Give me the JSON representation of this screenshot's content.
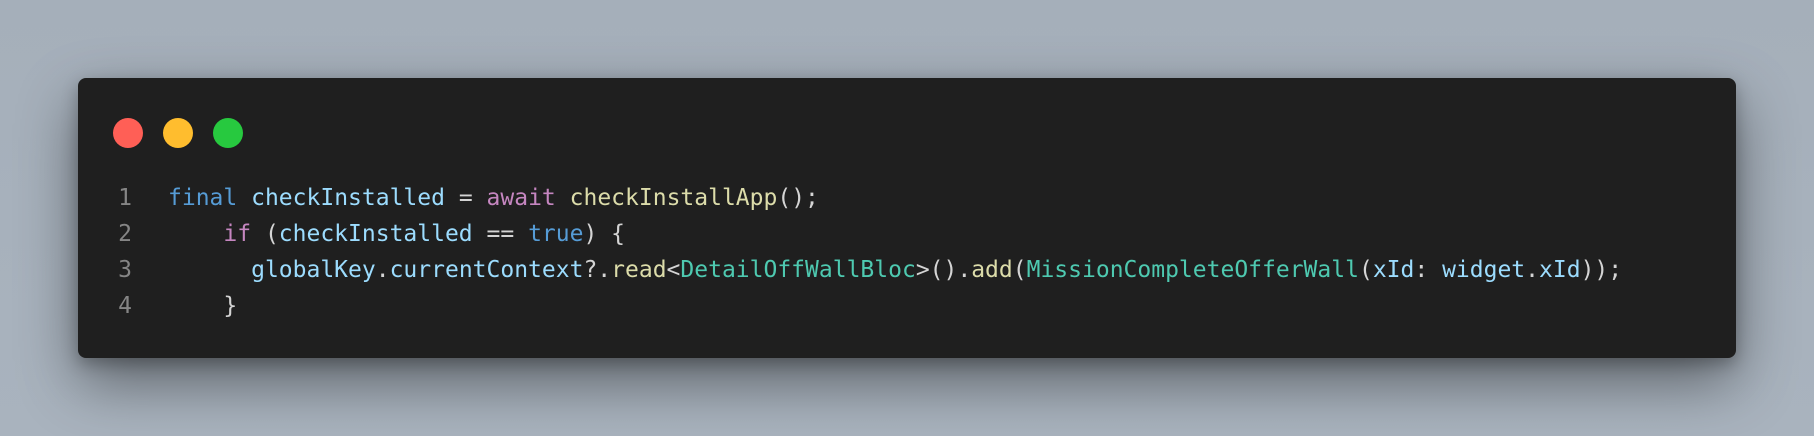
{
  "window": {
    "buttons": [
      {
        "name": "close",
        "color": "#ff5f56"
      },
      {
        "name": "minimize",
        "color": "#ffbd2e"
      },
      {
        "name": "zoom",
        "color": "#27c93f"
      }
    ]
  },
  "colors": {
    "keyword_blue": "#569cd6",
    "keyword_purple": "#c586c0",
    "variable": "#9cdcfe",
    "function": "#dcdcaa",
    "type": "#4ec9b0",
    "plain": "#d4d4d4",
    "line_number": "#858585"
  },
  "code": {
    "lines": [
      {
        "number": "1",
        "tokens": [
          {
            "t": "final",
            "c": "keyword_blue"
          },
          {
            "t": " ",
            "c": "plain"
          },
          {
            "t": "checkInstalled",
            "c": "variable"
          },
          {
            "t": " = ",
            "c": "plain"
          },
          {
            "t": "await",
            "c": "keyword_purple"
          },
          {
            "t": " ",
            "c": "plain"
          },
          {
            "t": "checkInstallApp",
            "c": "function"
          },
          {
            "t": "();",
            "c": "plain"
          }
        ]
      },
      {
        "number": "2",
        "tokens": [
          {
            "t": "    ",
            "c": "plain"
          },
          {
            "t": "if",
            "c": "keyword_purple"
          },
          {
            "t": " (",
            "c": "plain"
          },
          {
            "t": "checkInstalled",
            "c": "variable"
          },
          {
            "t": " == ",
            "c": "plain"
          },
          {
            "t": "true",
            "c": "keyword_blue"
          },
          {
            "t": ") {",
            "c": "plain"
          }
        ]
      },
      {
        "number": "3",
        "tokens": [
          {
            "t": "      ",
            "c": "plain"
          },
          {
            "t": "globalKey",
            "c": "variable"
          },
          {
            "t": ".",
            "c": "plain"
          },
          {
            "t": "currentContext",
            "c": "variable"
          },
          {
            "t": "?.",
            "c": "plain"
          },
          {
            "t": "read",
            "c": "function"
          },
          {
            "t": "<",
            "c": "plain"
          },
          {
            "t": "DetailOffWallBloc",
            "c": "type"
          },
          {
            "t": ">().",
            "c": "plain"
          },
          {
            "t": "add",
            "c": "function"
          },
          {
            "t": "(",
            "c": "plain"
          },
          {
            "t": "MissionCompleteOfferWall",
            "c": "type"
          },
          {
            "t": "(",
            "c": "plain"
          },
          {
            "t": "xId",
            "c": "variable"
          },
          {
            "t": ": ",
            "c": "plain"
          },
          {
            "t": "widget",
            "c": "variable"
          },
          {
            "t": ".",
            "c": "plain"
          },
          {
            "t": "xId",
            "c": "variable"
          },
          {
            "t": "));",
            "c": "plain"
          }
        ]
      },
      {
        "number": "4",
        "tokens": [
          {
            "t": "    }",
            "c": "plain"
          }
        ]
      }
    ]
  }
}
